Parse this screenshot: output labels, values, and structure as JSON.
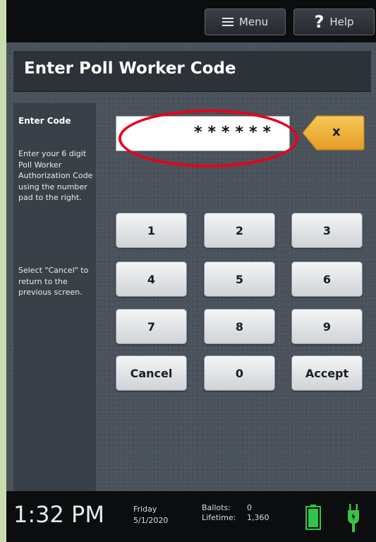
{
  "topbar": {
    "menu_label": "Menu",
    "help_label": "Help",
    "help_icon": "?"
  },
  "page": {
    "title": "Enter Poll Worker Code"
  },
  "sidebar": {
    "title": "Enter Code",
    "instructions": "Enter your 6 digit Poll Worker Authorization Code using the number pad to the right.",
    "cancel_hint": "Select \"Cancel\" to return to the previous screen."
  },
  "code_entry": {
    "masked_value": "******",
    "clear_label": "x"
  },
  "keypad": {
    "keys": [
      "1",
      "2",
      "3",
      "4",
      "5",
      "6",
      "7",
      "8",
      "9",
      "Cancel",
      "0",
      "Accept"
    ]
  },
  "status": {
    "time": "1:32 PM",
    "day": "Friday",
    "date": "5/1/2020",
    "ballots_label": "Ballots:",
    "ballots_value": "0",
    "lifetime_label": "Lifetime:",
    "lifetime_value": "1,360"
  },
  "colors": {
    "highlight": "#e8001c",
    "clear_button": "#f2b23a",
    "battery": "#2fc44a",
    "plug": "#3cc145"
  }
}
